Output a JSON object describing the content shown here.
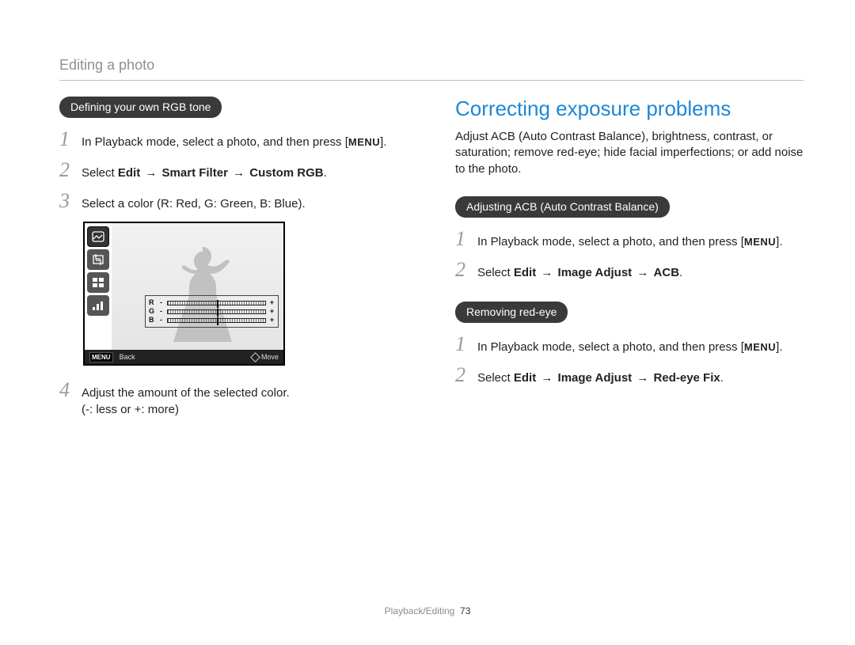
{
  "header": {
    "title": "Editing a photo"
  },
  "left": {
    "pill": "Defining your own RGB tone",
    "steps": [
      {
        "pre": "In Playback mode, select a photo, and then press [",
        "menu": "MENU",
        "post": "]."
      },
      {
        "select": "Select ",
        "edit": "Edit",
        "arrow1": " → ",
        "a": "Smart Filter",
        "arrow2": " → ",
        "b": "Custom RGB",
        "end": "."
      },
      {
        "text": "Select a color (R: Red, G: Green, B: Blue)."
      },
      {
        "text": "Adjust the amount of the selected color.",
        "sub": "(-: less or +: more)"
      }
    ],
    "lcd": {
      "rgb_labels": [
        "R",
        "G",
        "B"
      ],
      "footer_back_key": "MENU",
      "footer_back": "Back",
      "footer_move": "Move"
    }
  },
  "right": {
    "heading": "Correcting exposure problems",
    "intro": "Adjust ACB (Auto Contrast Balance), brightness, contrast, or saturation; remove red-eye; hide facial imperfections; or add noise to the photo.",
    "sections": [
      {
        "pill": "Adjusting ACB (Auto Contrast Balance)",
        "steps": [
          {
            "pre": "In Playback mode, select a photo, and then press [",
            "menu": "MENU",
            "post": "]."
          },
          {
            "select": "Select ",
            "edit": "Edit",
            "arrow1": " → ",
            "a": "Image Adjust",
            "arrow2": " → ",
            "b": "ACB",
            "end": "."
          }
        ]
      },
      {
        "pill": "Removing red-eye",
        "steps": [
          {
            "pre": "In Playback mode, select a photo, and then press [",
            "menu": "MENU",
            "post": "]."
          },
          {
            "select": "Select ",
            "edit": "Edit",
            "arrow1": " → ",
            "a": "Image Adjust",
            "arrow2": " → ",
            "b": "Red-eye Fix",
            "end": "."
          }
        ]
      }
    ]
  },
  "footer": {
    "section": "Playback/Editing",
    "page": "73"
  }
}
